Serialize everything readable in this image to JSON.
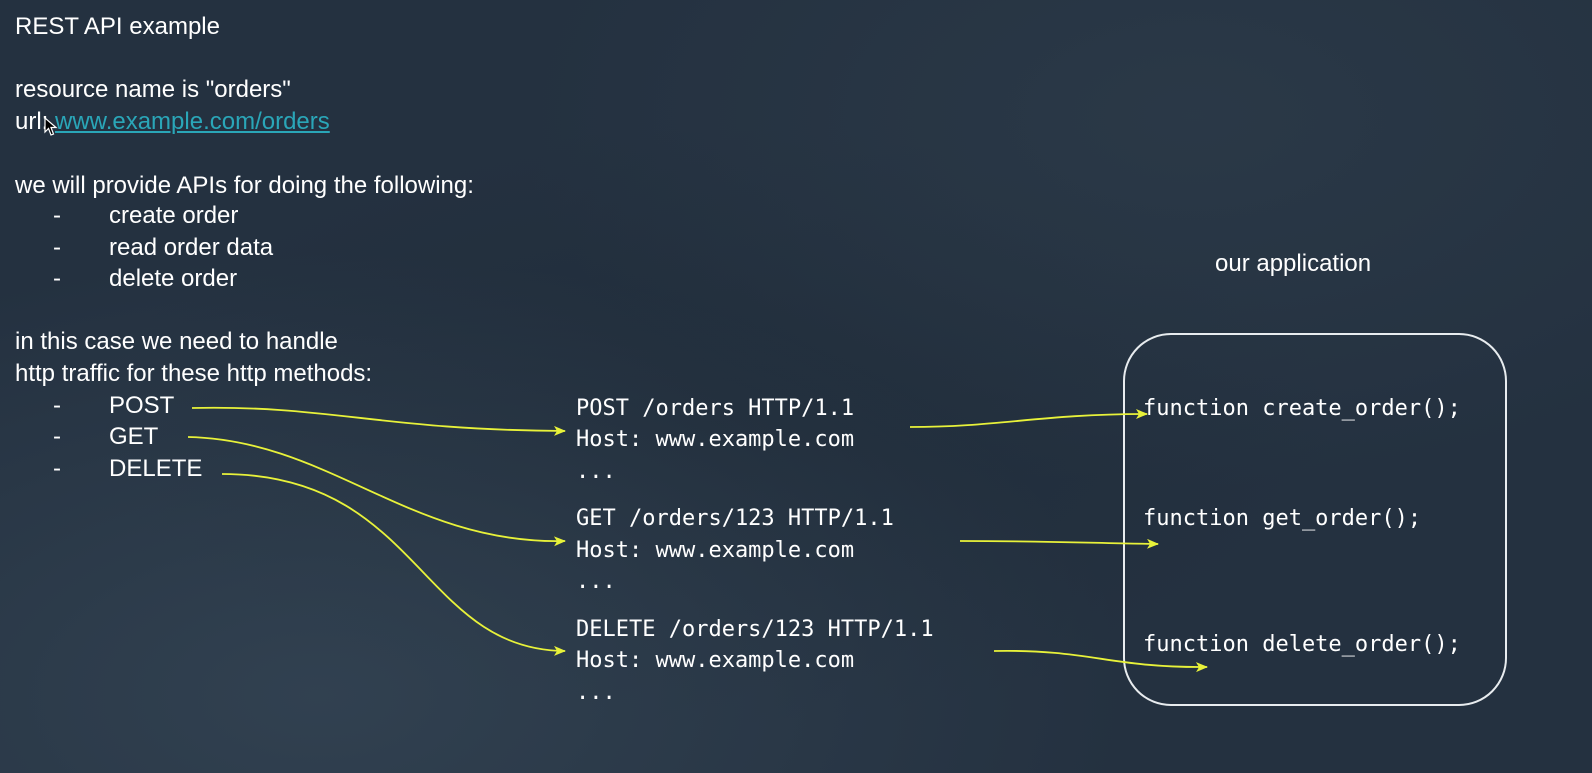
{
  "title": "REST API example",
  "resource_line": "resource name is \"orders\"",
  "url": {
    "prefix": "url: ",
    "link": "www.example.com/orders"
  },
  "apis_intro": "we will provide APIs for doing the following:",
  "apis": [
    {
      "dash": "-",
      "label": "create order"
    },
    {
      "dash": "-",
      "label": "read order data"
    },
    {
      "dash": "-",
      "label": "delete order"
    }
  ],
  "handle_intro": {
    "line1": "in this case we need to handle",
    "line2": "http traffic for these http methods:"
  },
  "methods": [
    {
      "dash": "-",
      "label": "POST"
    },
    {
      "dash": "-",
      "label": "GET"
    },
    {
      "dash": "-",
      "label": "DELETE"
    }
  ],
  "requests": [
    {
      "line1": "POST /orders HTTP/1.1",
      "line2": "Host: www.example.com",
      "line3": "..."
    },
    {
      "line1": "GET /orders/123 HTTP/1.1",
      "line2": "Host: www.example.com",
      "line3": "..."
    },
    {
      "line1": "DELETE /orders/123 HTTP/1.1",
      "line2": "Host: www.example.com",
      "line3": "..."
    }
  ],
  "application": {
    "label": "our application",
    "functions": [
      "function create_order();",
      "function get_order();",
      "function delete_order();"
    ]
  },
  "colors": {
    "background": "#243140",
    "text": "#ffffff",
    "link": "#2aa6b8",
    "arrow": "#e8f23a",
    "box_border": "#e8ecef"
  },
  "icons": {
    "cursor": "mouse-pointer-icon"
  }
}
